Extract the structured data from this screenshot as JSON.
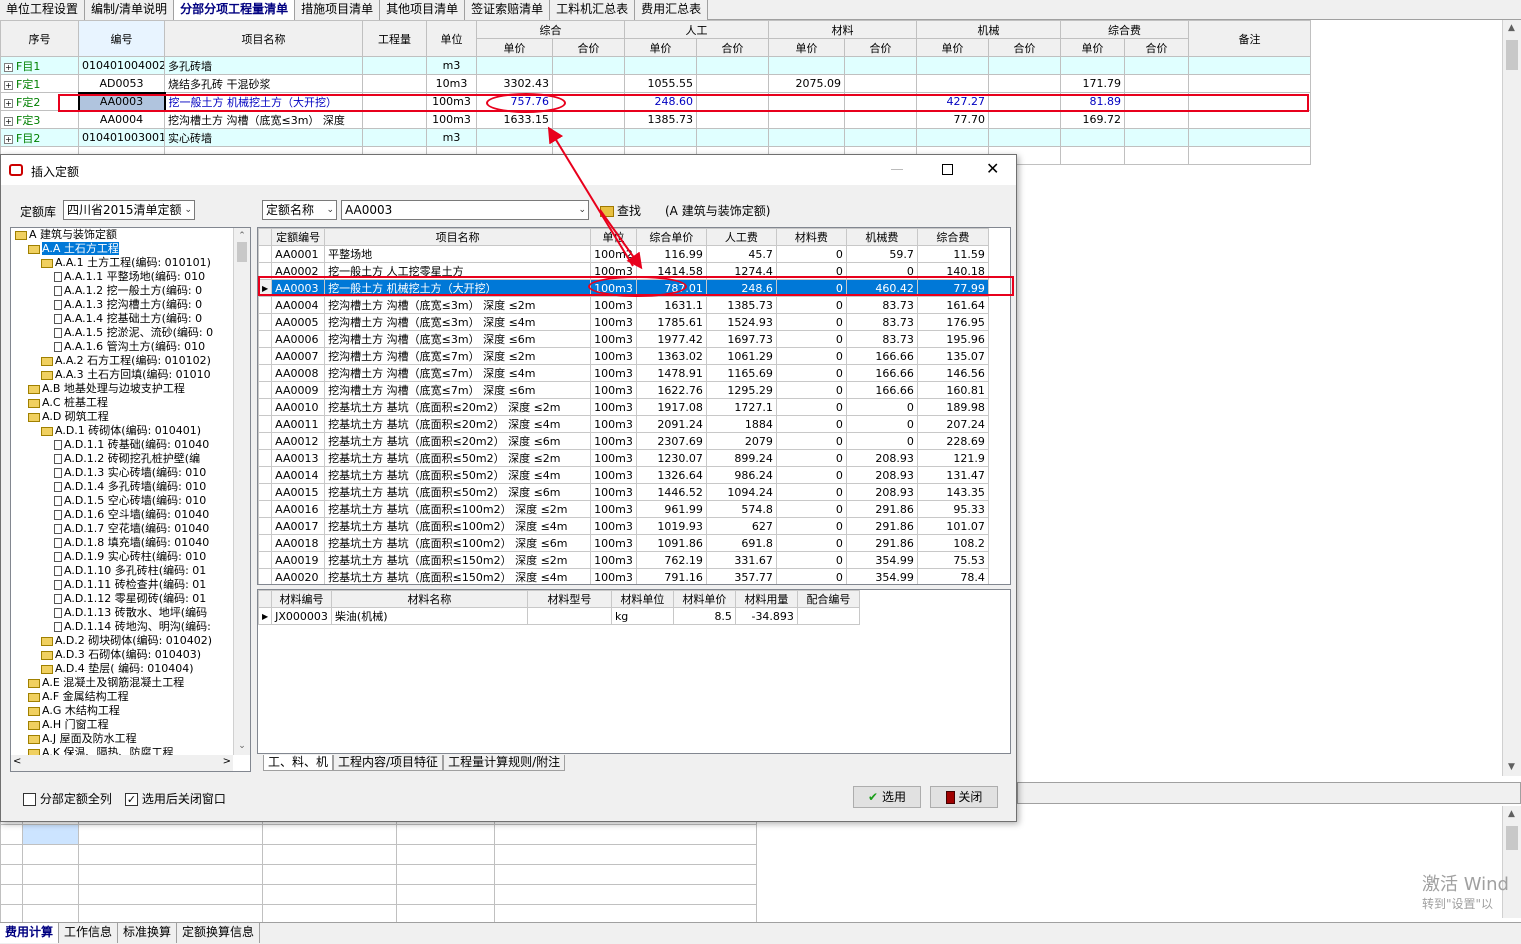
{
  "tabs": [
    "单位工程设置",
    "编制/清单说明",
    "分部分项工程量清单",
    "措施项目清单",
    "其他项目清单",
    "签证索赔清单",
    "工料机汇总表",
    "费用汇总表"
  ],
  "active_tab_index": 2,
  "main_grid": {
    "headers": {
      "seq": "序号",
      "code": "编号",
      "name": "项目名称",
      "qty": "工程量",
      "unit": "单位",
      "group_total": "综合",
      "group_labor": "人工",
      "group_material": "材料",
      "group_machine": "机械",
      "group_fee": "综合费",
      "unit_price": "单价",
      "total_price": "合价",
      "remark": "备注"
    },
    "rows": [
      {
        "seq": "F目1",
        "code": "010401004002",
        "name": "多孔砖墙",
        "unit": "m3",
        "total_up": "",
        "labor_up": "",
        "material_up": "",
        "machine_up": "",
        "fee_up": ""
      },
      {
        "seq": "F定1",
        "code": "AD0053",
        "name": "烧结多孔砖 干混砂浆",
        "unit": "10m3",
        "total_up": "3302.43",
        "labor_up": "1055.55",
        "material_up": "2075.09",
        "machine_up": "",
        "fee_up": "171.79"
      },
      {
        "seq": "F定2",
        "code": "AA0003",
        "name": "挖一般土方 机械挖土方（大开挖）",
        "unit": "100m3",
        "total_up": "757.76",
        "labor_up": "248.60",
        "material_up": "",
        "machine_up": "427.27",
        "fee_up": "81.89"
      },
      {
        "seq": "F定3",
        "code": "AA0004",
        "name": "挖沟槽土方 沟槽（底宽≤3m） 深度",
        "unit": "100m3",
        "total_up": "1633.15",
        "labor_up": "1385.73",
        "material_up": "",
        "machine_up": "77.70",
        "fee_up": "169.72"
      },
      {
        "seq": "F目2",
        "code": "010401003001",
        "name": "实心砖墙",
        "unit": "m3",
        "total_up": "",
        "labor_up": "",
        "material_up": "",
        "machine_up": "",
        "fee_up": ""
      }
    ]
  },
  "dialog": {
    "title": "插入定额",
    "lib_label": "定额库",
    "lib_value": "四川省2015清单定额",
    "search_by": "定额名称",
    "search_value": "AA0003",
    "find_label": "查找",
    "find_hint": "(A 建筑与装饰定额)",
    "tree": [
      {
        "level": 0,
        "text": "A 建筑与装饰定额",
        "type": "open"
      },
      {
        "level": 1,
        "text": "A.A 土石方工程",
        "type": "open",
        "selected": true
      },
      {
        "level": 2,
        "text": "A.A.1 土方工程(编码: 010101)",
        "type": "open"
      },
      {
        "level": 3,
        "text": "A.A.1.1 平整场地(编码: 010",
        "type": "doc"
      },
      {
        "level": 3,
        "text": "A.A.1.2 挖一般土方(编码: 0",
        "type": "doc"
      },
      {
        "level": 3,
        "text": "A.A.1.3 挖沟槽土方(编码: 0",
        "type": "doc"
      },
      {
        "level": 3,
        "text": "A.A.1.4 挖基础土方(编码: 0",
        "type": "doc"
      },
      {
        "level": 3,
        "text": "A.A.1.5 挖淤泥、流砂(编码: 0",
        "type": "doc"
      },
      {
        "level": 3,
        "text": "A.A.1.6 管沟土方(编码: 010",
        "type": "doc"
      },
      {
        "level": 2,
        "text": "A.A.2 石方工程(编码: 010102)",
        "type": "closed"
      },
      {
        "level": 2,
        "text": "A.A.3 土石方回填(编码: 01010",
        "type": "closed"
      },
      {
        "level": 1,
        "text": "A.B 地基处理与边坡支护工程",
        "type": "closed"
      },
      {
        "level": 1,
        "text": "A.C 桩基工程",
        "type": "closed"
      },
      {
        "level": 1,
        "text": "A.D 砌筑工程",
        "type": "open"
      },
      {
        "level": 2,
        "text": "A.D.1 砖砌体(编码: 010401)",
        "type": "open"
      },
      {
        "level": 3,
        "text": "A.D.1.1 砖基础(编码: 01040",
        "type": "doc"
      },
      {
        "level": 3,
        "text": "A.D.1.2 砖砌挖孔桩护壁(编",
        "type": "doc"
      },
      {
        "level": 3,
        "text": "A.D.1.3 实心砖墙(编码: 010",
        "type": "doc"
      },
      {
        "level": 3,
        "text": "A.D.1.4 多孔砖墙(编码: 010",
        "type": "doc"
      },
      {
        "level": 3,
        "text": "A.D.1.5 空心砖墙(编码: 010",
        "type": "doc"
      },
      {
        "level": 3,
        "text": "A.D.1.6 空斗墙(编码: 01040",
        "type": "doc"
      },
      {
        "level": 3,
        "text": "A.D.1.7 空花墙(编码: 01040",
        "type": "doc"
      },
      {
        "level": 3,
        "text": "A.D.1.8 填充墙(编码: 01040",
        "type": "doc"
      },
      {
        "level": 3,
        "text": "A.D.1.9 实心砖柱(编码: 010",
        "type": "doc"
      },
      {
        "level": 3,
        "text": "A.D.1.10 多孔砖柱(编码: 01",
        "type": "doc"
      },
      {
        "level": 3,
        "text": "A.D.1.11 砖检查井(编码: 01",
        "type": "doc"
      },
      {
        "level": 3,
        "text": "A.D.1.12 零星砌砖(编码: 01",
        "type": "doc"
      },
      {
        "level": 3,
        "text": "A.D.1.13 砖散水、地坪(编码",
        "type": "doc"
      },
      {
        "level": 3,
        "text": "A.D.1.14 砖地沟、明沟(编码:",
        "type": "doc"
      },
      {
        "level": 2,
        "text": "A.D.2 砌块砌体(编码: 010402)",
        "type": "closed"
      },
      {
        "level": 2,
        "text": "A.D.3 石砌体(编码: 010403)",
        "type": "closed"
      },
      {
        "level": 2,
        "text": "A.D.4 垫层( 编码: 010404)",
        "type": "closed"
      },
      {
        "level": 1,
        "text": "A.E 混凝土及钢筋混凝土工程",
        "type": "closed"
      },
      {
        "level": 1,
        "text": "A.F 金属结构工程",
        "type": "closed"
      },
      {
        "level": 1,
        "text": "A.G 木结构工程",
        "type": "closed"
      },
      {
        "level": 1,
        "text": "A.H 门窗工程",
        "type": "closed"
      },
      {
        "level": 1,
        "text": "A.J 屋面及防水工程",
        "type": "closed"
      },
      {
        "level": 1,
        "text": "A.K 保温、隔热、防腐工程",
        "type": "closed"
      }
    ],
    "grid_headers": [
      "定额编号",
      "项目名称",
      "单位",
      "综合单价",
      "人工费",
      "材料费",
      "机械费",
      "综合费"
    ],
    "grid_rows": [
      [
        "AA0001",
        "平整场地",
        "100m2",
        "116.99",
        "45.7",
        "0",
        "59.7",
        "11.59"
      ],
      [
        "AA0002",
        "挖一般土方 人工挖零星土方",
        "100m3",
        "1414.58",
        "1274.4",
        "0",
        "0",
        "140.18"
      ],
      [
        "AA0003",
        "挖一般土方 机械挖土方（大开挖）",
        "100m3",
        "787.01",
        "248.6",
        "0",
        "460.42",
        "77.99"
      ],
      [
        "AA0004",
        "挖沟槽土方 沟槽（底宽≤3m） 深度 ≤2m",
        "100m3",
        "1631.1",
        "1385.73",
        "0",
        "83.73",
        "161.64"
      ],
      [
        "AA0005",
        "挖沟槽土方 沟槽（底宽≤3m） 深度 ≤4m",
        "100m3",
        "1785.61",
        "1524.93",
        "0",
        "83.73",
        "176.95"
      ],
      [
        "AA0006",
        "挖沟槽土方 沟槽（底宽≤3m） 深度 ≤6m",
        "100m3",
        "1977.42",
        "1697.73",
        "0",
        "83.73",
        "195.96"
      ],
      [
        "AA0007",
        "挖沟槽土方 沟槽（底宽≤7m） 深度 ≤2m",
        "100m3",
        "1363.02",
        "1061.29",
        "0",
        "166.66",
        "135.07"
      ],
      [
        "AA0008",
        "挖沟槽土方 沟槽（底宽≤7m） 深度 ≤4m",
        "100m3",
        "1478.91",
        "1165.69",
        "0",
        "166.66",
        "146.56"
      ],
      [
        "AA0009",
        "挖沟槽土方 沟槽（底宽≤7m） 深度 ≤6m",
        "100m3",
        "1622.76",
        "1295.29",
        "0",
        "166.66",
        "160.81"
      ],
      [
        "AA0010",
        "挖基坑土方 基坑（底面积≤20m2） 深度 ≤2m",
        "100m3",
        "1917.08",
        "1727.1",
        "0",
        "0",
        "189.98"
      ],
      [
        "AA0011",
        "挖基坑土方 基坑（底面积≤20m2） 深度 ≤4m",
        "100m3",
        "2091.24",
        "1884",
        "0",
        "0",
        "207.24"
      ],
      [
        "AA0012",
        "挖基坑土方 基坑（底面积≤20m2） 深度 ≤6m",
        "100m3",
        "2307.69",
        "2079",
        "0",
        "0",
        "228.69"
      ],
      [
        "AA0013",
        "挖基坑土方 基坑（底面积≤50m2） 深度 ≤2m",
        "100m3",
        "1230.07",
        "899.24",
        "0",
        "208.93",
        "121.9"
      ],
      [
        "AA0014",
        "挖基坑土方 基坑（底面积≤50m2） 深度 ≤4m",
        "100m3",
        "1326.64",
        "986.24",
        "0",
        "208.93",
        "131.47"
      ],
      [
        "AA0015",
        "挖基坑土方 基坑（底面积≤50m2） 深度 ≤6m",
        "100m3",
        "1446.52",
        "1094.24",
        "0",
        "208.93",
        "143.35"
      ],
      [
        "AA0016",
        "挖基坑土方 基坑（底面积≤100m2） 深度 ≤2m",
        "100m3",
        "961.99",
        "574.8",
        "0",
        "291.86",
        "95.33"
      ],
      [
        "AA0017",
        "挖基坑土方 基坑（底面积≤100m2） 深度 ≤4m",
        "100m3",
        "1019.93",
        "627",
        "0",
        "291.86",
        "101.07"
      ],
      [
        "AA0018",
        "挖基坑土方 基坑（底面积≤100m2） 深度 ≤6m",
        "100m3",
        "1091.86",
        "691.8",
        "0",
        "291.86",
        "108.2"
      ],
      [
        "AA0019",
        "挖基坑土方 基坑（底面积≤150m2） 深度 ≤2m",
        "100m3",
        "762.19",
        "331.67",
        "0",
        "354.99",
        "75.53"
      ],
      [
        "AA0020",
        "挖基坑土方 基坑（底面积≤150m2） 深度 ≤4m",
        "100m3",
        "791.16",
        "357.77",
        "0",
        "354.99",
        "78.4"
      ]
    ],
    "selected_row_index": 2,
    "material_headers": [
      "材料编号",
      "材料名称",
      "材料型号",
      "材料单位",
      "材料单价",
      "材料用量",
      "配合编号"
    ],
    "material_rows": [
      [
        "JX000003",
        "柴油(机械)",
        "",
        "kg",
        "8.5",
        "-34.893",
        ""
      ]
    ],
    "bottom_tabs": [
      "工、料、机",
      "工程内容/项目特征",
      "工程量计算规则/附注"
    ],
    "chk_all_label": "分部定额全列",
    "chk_close_label": "选用后关闭窗口",
    "chk_close_checked": true,
    "select_btn": "选用",
    "close_btn": "关闭"
  },
  "status_tabs": [
    "费用计算",
    "工作信息",
    "标准换算",
    "定额换算信息"
  ],
  "watermark": {
    "line1": "激活 Wind",
    "line2": "转到\"设置\"以"
  },
  "colors": {
    "selected": "#0078d7",
    "annotation": "#e8001c",
    "cyan_row": "#e0ffff",
    "active_tab_text": "#000080"
  }
}
